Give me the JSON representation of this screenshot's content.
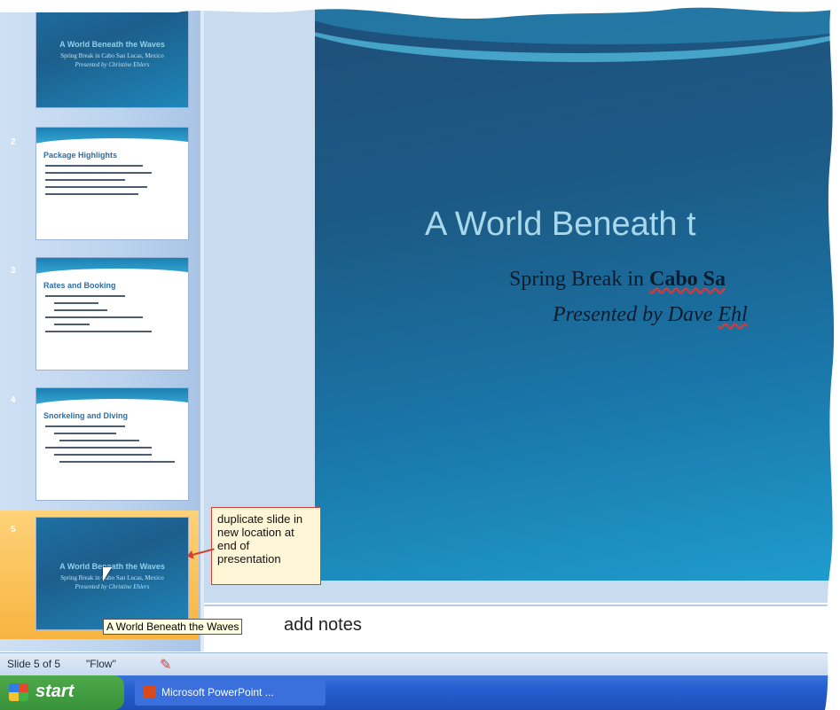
{
  "slide_pane": {
    "thumbnails": [
      {
        "number": "",
        "title": "A World Beneath the Waves",
        "lines": [
          "Spring Break in Cabo San Lucas, Mexico",
          "Presented by Christine Ehlers"
        ]
      },
      {
        "number": "2",
        "title": "Package Highlights"
      },
      {
        "number": "3",
        "title": "Rates and Booking"
      },
      {
        "number": "4",
        "title": "Snorkeling and Diving"
      },
      {
        "number": "5",
        "title": "A World Beneath the Waves",
        "lines": [
          "Spring Break in Cabo San Lucas, Mexico",
          "Presented by Christine Ehlers"
        ]
      }
    ]
  },
  "slide": {
    "title": "A World Beneath t",
    "subtitle_prefix": "Spring Break in ",
    "subtitle_bold": "Cabo Sa",
    "presenter_prefix": "Presented by Dave ",
    "presenter_name": "Ehl"
  },
  "notes": {
    "placeholder_visible": "add notes"
  },
  "tooltip": "A World Beneath the Waves",
  "callout": "duplicate slide in new location at end of presentation",
  "status_bar": {
    "slide_info": "Slide 5 of 5",
    "theme": "\"Flow\""
  },
  "taskbar": {
    "start_label": "start",
    "task_label": "Microsoft PowerPoint ..."
  }
}
